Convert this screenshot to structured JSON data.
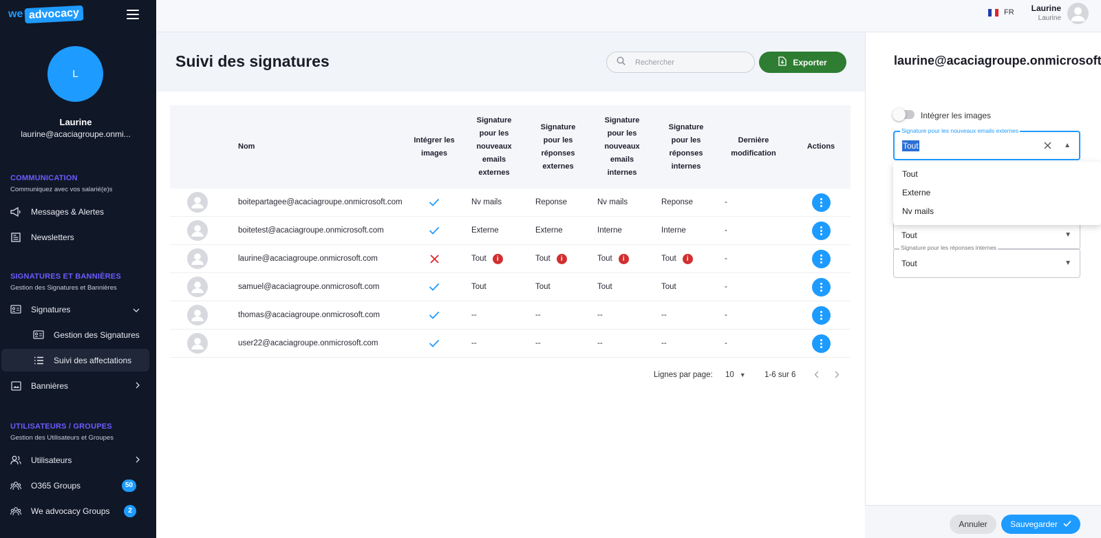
{
  "brand": {
    "we": "we",
    "advocacy": "advocacy",
    "color": "#1e9bff"
  },
  "sidebar": {
    "profile": {
      "initial": "L",
      "name": "Laurine",
      "email": "laurine@acaciagroupe.onmi..."
    },
    "sections": [
      {
        "title": "COMMUNICATION",
        "subtitle": "Communiquez avec vos salarié(e)s"
      },
      {
        "title": "SIGNATURES ET BANNIÈRES",
        "subtitle": "Gestion des Signatures et Bannières"
      },
      {
        "title": "UTILISATEURS / GROUPES",
        "subtitle": "Gestion des Utilisateurs et Groupes"
      }
    ],
    "items": [
      {
        "label": "Messages & Alertes",
        "icon": "megaphone-icon"
      },
      {
        "label": "Newsletters",
        "icon": "newspaper-icon"
      },
      {
        "label": "Signatures",
        "icon": "id-card-icon"
      },
      {
        "label": "Gestion des Signatures",
        "icon": "id-card-icon"
      },
      {
        "label": "Suivi des affectations",
        "icon": "list-icon"
      },
      {
        "label": "Bannières",
        "icon": "image-icon"
      },
      {
        "label": "Utilisateurs",
        "icon": "users-icon"
      },
      {
        "label": "O365 Groups",
        "icon": "group-icon",
        "badge": "50"
      },
      {
        "label": "We advocacy Groups",
        "icon": "group-icon",
        "badge": "2"
      }
    ]
  },
  "topbar": {
    "lang": "FR",
    "user_name": "Laurine",
    "user_role": "Laurine"
  },
  "main": {
    "title": "Suivi des signatures",
    "search_placeholder": "Rechercher",
    "export_label": "Exporter",
    "columns": [
      "Nom",
      "Intégrer les images",
      "Signature pour les nouveaux emails externes",
      "Signature pour les réponses externes",
      "Signature pour les nouveaux emails internes",
      "Signature pour les réponses internes",
      "Dernière modification",
      "Actions"
    ],
    "rows": [
      {
        "email": "boitepartagee@acaciagroupe.onmicrosoft.com",
        "images": "check",
        "new_ext": "Nv mails",
        "rep_ext": "Reponse",
        "new_int": "Nv mails",
        "rep_int": "Reponse",
        "modified": "-",
        "warn": false
      },
      {
        "email": "boitetest@acaciagroupe.onmicrosoft.com",
        "images": "check",
        "new_ext": "Externe",
        "rep_ext": "Externe",
        "new_int": "Interne",
        "rep_int": "Interne",
        "modified": "-",
        "warn": false
      },
      {
        "email": "laurine@acaciagroupe.onmicrosoft.com",
        "images": "cross",
        "new_ext": "Tout",
        "rep_ext": "Tout",
        "new_int": "Tout",
        "rep_int": "Tout",
        "modified": "-",
        "warn": true
      },
      {
        "email": "samuel@acaciagroupe.onmicrosoft.com",
        "images": "check",
        "new_ext": "Tout",
        "rep_ext": "Tout",
        "new_int": "Tout",
        "rep_int": "Tout",
        "modified": "-",
        "warn": false
      },
      {
        "email": "thomas@acaciagroupe.onmicrosoft.com",
        "images": "check",
        "new_ext": "--",
        "rep_ext": "--",
        "new_int": "--",
        "rep_int": "--",
        "modified": "-",
        "warn": false
      },
      {
        "email": "user22@acaciagroupe.onmicrosoft.com",
        "images": "check",
        "new_ext": "--",
        "rep_ext": "--",
        "new_int": "--",
        "rep_int": "--",
        "modified": "-",
        "warn": false
      }
    ],
    "pagination": {
      "rows_label": "Lignes par page:",
      "rows_value": "10",
      "range": "1-6 sur 6"
    }
  },
  "panel": {
    "title": "laurine@acaciagroupe.onmicrosoft.com",
    "toggle_label": "Intégrer les images",
    "toggle_on": false,
    "field_new_ext": {
      "legend": "Signature pour les nouveaux emails externes",
      "value": "Tout"
    },
    "field_hidden": {
      "value": "Tout"
    },
    "field_rep_int": {
      "legend": "Signature pour les réponses internes",
      "value": "Tout"
    },
    "dropdown_options": [
      "Tout",
      "Externe",
      "Nv mails"
    ],
    "cancel_label": "Annuler",
    "save_label": "Sauvegarder"
  }
}
